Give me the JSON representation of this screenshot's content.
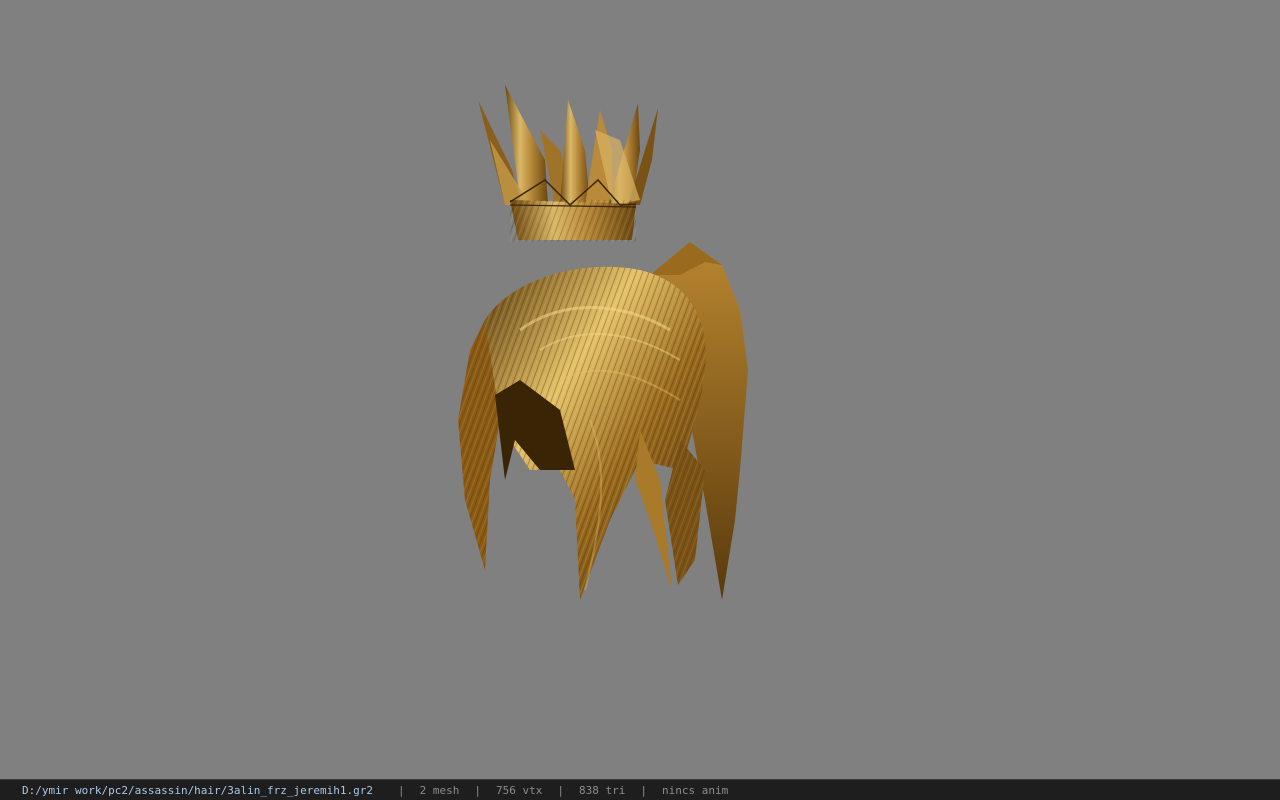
{
  "viewer": {
    "background": "#808080",
    "model_colors": {
      "hair_dark": "#5a3a0c",
      "hair_mid": "#9a6a1e",
      "hair_light": "#e6c46a",
      "crown_dark": "#6a4610",
      "crown_light": "#d9b868"
    }
  },
  "status": {
    "file_path": "D:/ymir work/pc2/assassin/hair/3alin_frz_jeremih1.gr2",
    "mesh": "2 mesh",
    "vertices": "756 vtx",
    "triangles": "838 tri",
    "anim": "nincs anim"
  }
}
